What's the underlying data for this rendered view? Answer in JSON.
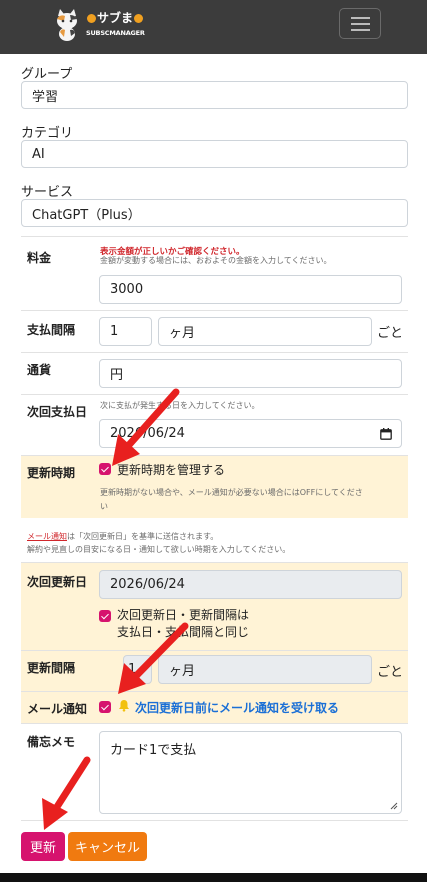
{
  "brand": {
    "name": "サブま",
    "subtitle": "SUBSCMANAGER"
  },
  "group": {
    "label": "グループ",
    "value": "学習"
  },
  "category": {
    "label": "カテゴリ",
    "value": "AI"
  },
  "service": {
    "label": "サービス",
    "value": "ChatGPT（Plus）"
  },
  "price": {
    "label": "料金",
    "warning": "表示金額が正しいかご確認ください。",
    "hint": "金額が変動する場合には、おおよその金額を入力してください。",
    "value": "3000"
  },
  "interval": {
    "label": "支払間隔",
    "value": "1",
    "unit": "ヶ月",
    "suffix": "ごと"
  },
  "currency": {
    "label": "通貨",
    "value": "円"
  },
  "next_payment": {
    "label": "次回支払日",
    "hint": "次に支払が発生する日を入力してください。",
    "value": "2026/06/24"
  },
  "renewal_timing": {
    "label": "更新時期",
    "checkbox_label": "更新時期を管理する",
    "hint_line1": "更新時期がない場合や、メール通知が必要ない場合にはOFFにしてくださ",
    "hint_line2": "い"
  },
  "mail_note": {
    "link": "メール通知",
    "line1_rest": "は「次回更新日」を基準に送信されます。",
    "line2": "解約や見直しの目安になる日・通知して欲しい時期を入力してください。"
  },
  "next_renewal": {
    "label": "次回更新日",
    "value": "2026/06/24",
    "same_line1": "次回更新日・更新間隔は",
    "same_line2": "支払日・支払間隔と同じ"
  },
  "renewal_interval": {
    "label": "更新間隔",
    "value": "1",
    "unit": "ヶ月",
    "suffix": "ごと"
  },
  "mail_notify": {
    "label": "メール通知",
    "checkbox_label": "次回更新日前にメール通知を受け取る"
  },
  "memo": {
    "label": "備忘メモ",
    "value": "カード1で支払"
  },
  "buttons": {
    "update": "更新",
    "cancel": "キャンセル"
  },
  "colors": {
    "accent": "#d6136e",
    "cancel": "#f07a10",
    "navbar": "#3c3c3c",
    "highlight": "#fff3d6",
    "link": "#1a6fd6",
    "arrow": "#e8201f"
  }
}
